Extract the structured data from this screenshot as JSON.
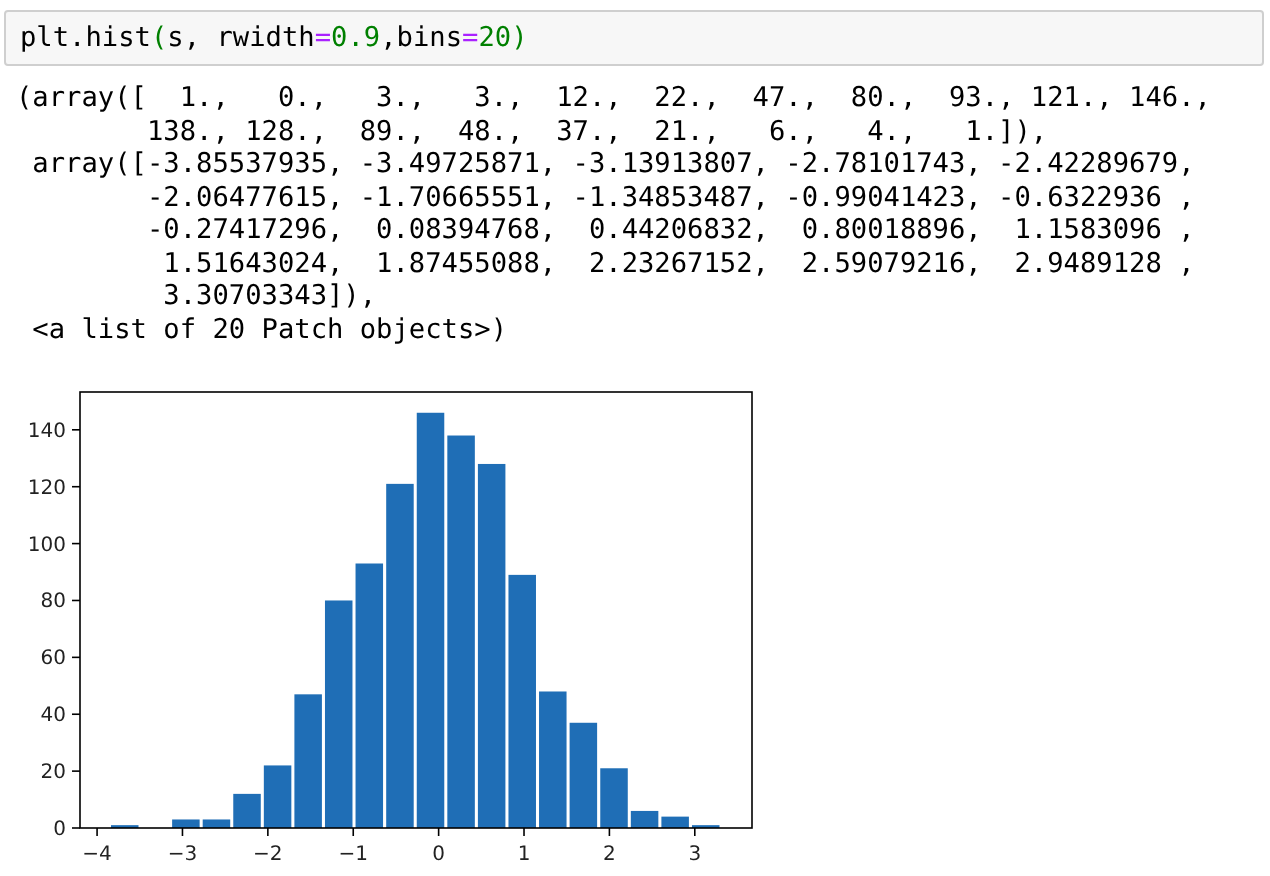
{
  "input_cell": {
    "tokens": [
      {
        "text": "plt.hist",
        "kind": "plain"
      },
      {
        "text": "(",
        "kind": "paren"
      },
      {
        "text": "s, rwidth",
        "kind": "plain"
      },
      {
        "text": "=",
        "kind": "op"
      },
      {
        "text": "0.9",
        "kind": "num"
      },
      {
        "text": ",bins",
        "kind": "plain"
      },
      {
        "text": "=",
        "kind": "op"
      },
      {
        "text": "20",
        "kind": "num"
      },
      {
        "text": ")",
        "kind": "paren"
      }
    ]
  },
  "output": {
    "lines": [
      "(array([  1.,   0.,   3.,   3.,  12.,  22.,  47.,  80.,  93., 121., 146.,",
      "        138., 128.,  89.,  48.,  37.,  21.,   6.,   4.,   1.]),",
      " array([-3.85537935, -3.49725871, -3.13913807, -2.78101743, -2.42289679,",
      "        -2.06477615, -1.70665551, -1.34853487, -0.99041423, -0.6322936 ,",
      "        -0.27417296,  0.08394768,  0.44206832,  0.80018896,  1.1583096 ,",
      "         1.51643024,  1.87455088,  2.23267152,  2.59079216,  2.9489128 ,",
      "         3.30703343]),",
      " <a list of 20 Patch objects>)"
    ],
    "chart_data": {
      "type": "bar",
      "x": [
        -3.676,
        -3.318,
        -2.96,
        -2.602,
        -2.244,
        -1.886,
        -1.528,
        -1.17,
        -0.812,
        -0.453,
        -0.095,
        0.263,
        0.621,
        0.979,
        1.337,
        1.695,
        2.054,
        2.412,
        2.77,
        3.128
      ],
      "series": [
        {
          "color": "#1f6eb6",
          "values": [
            1,
            0,
            3,
            3,
            12,
            22,
            47,
            80,
            93,
            121,
            146,
            138,
            128,
            89,
            48,
            37,
            21,
            6,
            4,
            1
          ]
        }
      ],
      "xlim": [
        -4.2,
        3.67
      ],
      "ylim": [
        0,
        153.3
      ],
      "xticks": [
        {
          "value": -4,
          "label": "−4"
        },
        {
          "value": -3,
          "label": "−3"
        },
        {
          "value": -2,
          "label": "−2"
        },
        {
          "value": -1,
          "label": "−1"
        },
        0,
        1,
        2,
        3
      ],
      "yticks": [
        0,
        20,
        40,
        60,
        80,
        100,
        120,
        140
      ]
    }
  }
}
